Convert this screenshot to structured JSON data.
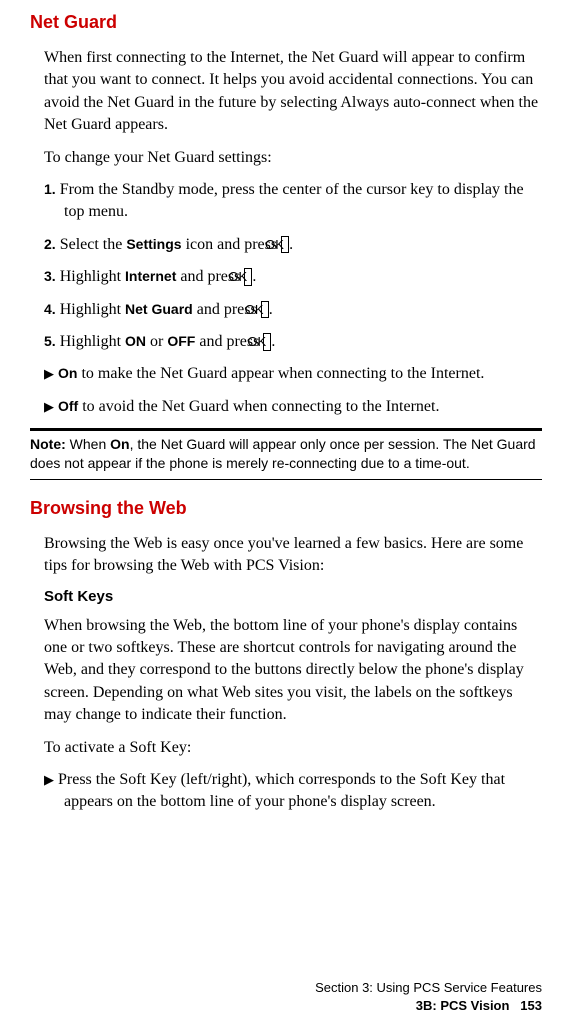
{
  "netguard": {
    "heading": "Net Guard",
    "intro": "When first connecting to the Internet, the Net Guard will appear to confirm that you want to connect. It helps you avoid accidental connections. You can avoid the Net Guard in the future by selecting Always auto-connect when the Net Guard appears.",
    "change_intro": "To change your Net Guard settings:",
    "steps": [
      {
        "num": "1.",
        "text_a": "From the Standby mode, press the center of the cursor key to display the top menu."
      },
      {
        "num": "2.",
        "text_a": "Select the ",
        "bold": "Settings",
        "text_b": " icon and press ",
        "ok": "OK",
        "text_c": "."
      },
      {
        "num": "3.",
        "text_a": "Highlight ",
        "bold": "Internet",
        "text_b": " and press ",
        "ok": "OK",
        "text_c": "."
      },
      {
        "num": "4.",
        "text_a": "Highlight ",
        "bold": "Net Guard",
        "text_b": " and press ",
        "ok": "OK",
        "text_c": "."
      },
      {
        "num": "5.",
        "text_a": "Highlight ",
        "bold": "ON",
        "mid": " or ",
        "bold2": "OFF",
        "text_b": " and press ",
        "ok": "OK",
        "text_c": "."
      }
    ],
    "bullets": [
      {
        "marker": "▶",
        "bold": "On",
        "text": " to make the Net Guard appear when connecting to the Internet."
      },
      {
        "marker": "▶",
        "bold": "Off",
        "text": " to avoid the Net Guard when connecting to the Internet."
      }
    ],
    "note": {
      "label": "Note:",
      "text_a": " When ",
      "bold": "On",
      "text_b": ", the Net Guard will appear only once per session. The Net Guard does not appear if the phone is merely re-connecting due to a time-out."
    }
  },
  "browsing": {
    "heading": "Browsing the Web",
    "intro": "Browsing the Web is easy once you've learned a few basics. Here are some tips for browsing the Web with PCS Vision:",
    "softkeys_heading": "Soft Keys",
    "softkeys_para": "When browsing the Web, the bottom line of your phone's display contains one or two softkeys. These are shortcut controls for navigating around the Web, and they correspond to the buttons directly below the phone's display screen. Depending on what Web sites you visit, the labels on the softkeys may change to indicate their function.",
    "activate_intro": "To activate a Soft Key:",
    "bullet": {
      "marker": "▶",
      "text": "Press the Soft Key (left/right), which corresponds to the Soft Key that appears on the bottom line of your phone's display screen."
    }
  },
  "footer": {
    "line1": "Section 3: Using PCS Service Features",
    "line2a": "3B: PCS Vision",
    "page": "153"
  }
}
